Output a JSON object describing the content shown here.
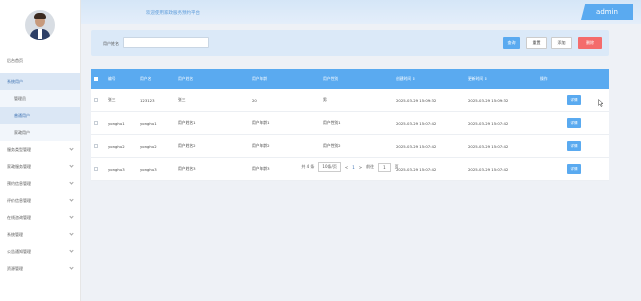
{
  "header": {
    "site_title": "欢迎使用家政服务预约平台",
    "user_badge": "admin"
  },
  "sidebar": {
    "items": [
      {
        "label": "后台首页",
        "has_chevron": false,
        "active": false
      },
      {
        "label": "系统用户",
        "has_chevron": false,
        "active": true
      }
    ],
    "sub_items": [
      {
        "label": "管理员",
        "selected": false
      },
      {
        "label": "普通用户",
        "selected": true
      },
      {
        "label": "家政用户",
        "selected": false
      }
    ],
    "groups": [
      {
        "label": "服务类型管理"
      },
      {
        "label": "家政服务管理"
      },
      {
        "label": "预约信息管理"
      },
      {
        "label": "评价信息管理"
      },
      {
        "label": "在线咨询管理"
      },
      {
        "label": "系统管理"
      },
      {
        "label": "公告通知管理"
      },
      {
        "label": "资源管理"
      }
    ]
  },
  "search": {
    "label": "用户姓名",
    "placeholder": "",
    "query_button": "查询",
    "reset_button": "重置",
    "add_button": "添加",
    "delete_button": "删除"
  },
  "table": {
    "headers": {
      "number": "编号",
      "username": "用户名",
      "name": "用户姓名",
      "age": "用户年龄",
      "gender": "用户性别",
      "created": "创建时间",
      "updated": "更新时间",
      "action": "操作"
    },
    "rows": [
      {
        "number": "张三",
        "username": "123123",
        "name": "张三",
        "age": "20",
        "gender": "男",
        "created": "2025-03-29 15:09:32",
        "updated": "2025-03-29 15:09:32",
        "action": "详情"
      },
      {
        "number": "yonghu1",
        "username": "yonghu1",
        "name": "用户姓名1",
        "age": "用户年龄1",
        "gender": "用户性别1",
        "created": "2025-03-29 15:07:42",
        "updated": "2025-03-29 15:07:42",
        "action": "详情"
      },
      {
        "number": "yonghu2",
        "username": "yonghu2",
        "name": "用户姓名2",
        "age": "用户年龄2",
        "gender": "用户性别2",
        "created": "2025-03-29 15:07:42",
        "updated": "2025-03-29 15:07:42",
        "action": "详情"
      },
      {
        "number": "yonghu3",
        "username": "yonghu3",
        "name": "用户姓名3",
        "age": "用户年龄3",
        "gender": "用户性别3",
        "created": "2025-03-29 15:07:42",
        "updated": "2025-03-29 15:07:42",
        "action": "详情"
      }
    ]
  },
  "pagination": {
    "total": "共 4 条",
    "page_size": "10条/页",
    "prev": "<",
    "current_page": "1",
    "next": ">",
    "goto_label": "前往",
    "goto_value": "1",
    "page_suffix": "页"
  },
  "colors": {
    "accent": "#5aaaf0",
    "danger": "#f46c6c",
    "panel": "#dbe9f8"
  }
}
